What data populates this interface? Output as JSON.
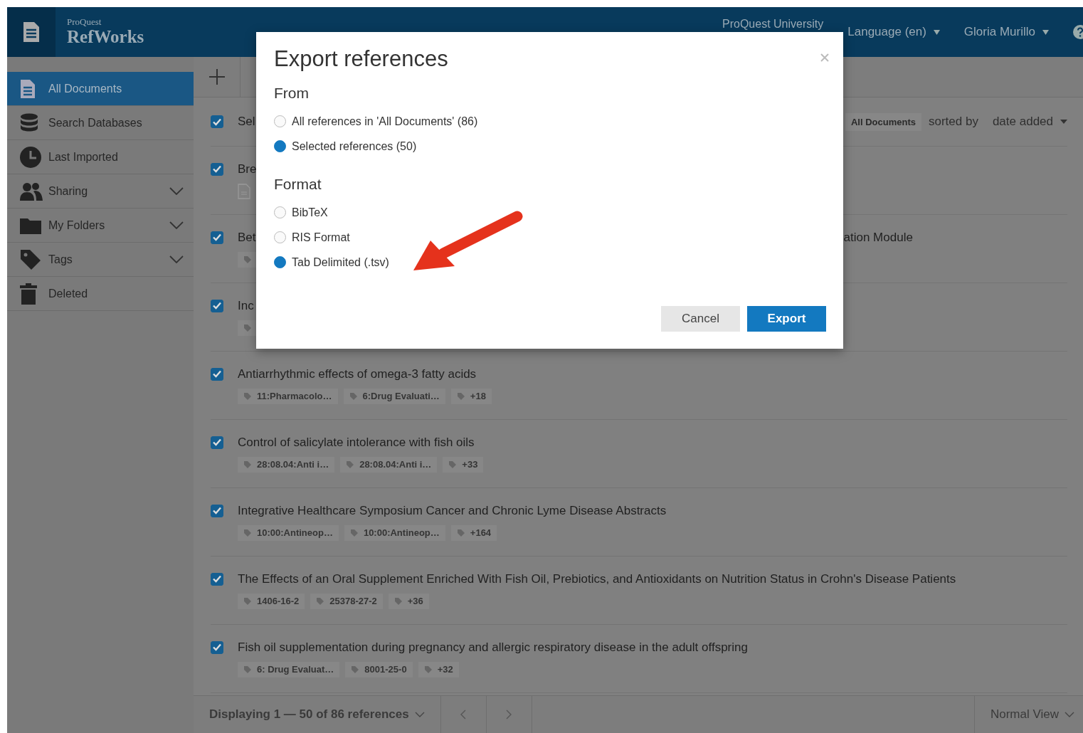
{
  "header": {
    "brand_small": "ProQuest",
    "brand": "RefWorks",
    "institution": "ProQuest University",
    "language": "Language (en)",
    "user": "Gloria Murillo"
  },
  "sidebar": {
    "items": [
      {
        "label": "All Documents",
        "selected": true,
        "expandable": false
      },
      {
        "label": "Search Databases",
        "selected": false,
        "expandable": false
      },
      {
        "label": "Last Imported",
        "selected": false,
        "expandable": false
      },
      {
        "label": "Sharing",
        "selected": false,
        "expandable": true
      },
      {
        "label": "My Folders",
        "selected": false,
        "expandable": true
      },
      {
        "label": "Tags",
        "selected": false,
        "expandable": true
      },
      {
        "label": "Deleted",
        "selected": false,
        "expandable": false
      }
    ]
  },
  "list": {
    "select_all": {
      "label": "Sel",
      "checked": true
    },
    "collection": "All Documents",
    "sort_label": "sorted by",
    "sort_value": "date added",
    "rows": [
      {
        "title": "Bre",
        "checked": true,
        "attachment": true,
        "tag_stub": false,
        "tags": []
      },
      {
        "title": "Bet",
        "title_tail": "ation Module",
        "checked": true,
        "attachment": false,
        "tag_stub": true,
        "tags": []
      },
      {
        "title": "Inc",
        "checked": true,
        "attachment": false,
        "tag_stub": true,
        "tags": []
      },
      {
        "title": "Antiarrhythmic effects of omega-3 fatty acids",
        "checked": true,
        "attachment": false,
        "tag_stub": false,
        "tags": [
          "11:Pharmacolo…",
          "6:Drug Evaluati…",
          "+18"
        ]
      },
      {
        "title": "Control of salicylate intolerance with fish oils",
        "checked": true,
        "attachment": false,
        "tag_stub": false,
        "tags": [
          "28:08.04:Anti i…",
          "28:08.04:Anti i…",
          "+33"
        ]
      },
      {
        "title": "Integrative Healthcare Symposium Cancer and Chronic Lyme Disease Abstracts",
        "checked": true,
        "attachment": false,
        "tag_stub": false,
        "tags": [
          "10:00:Antineop…",
          "10:00:Antineop…",
          "+164"
        ]
      },
      {
        "title": "The Effects of an Oral Supplement Enriched With Fish Oil, Prebiotics, and Antioxidants on Nutrition Status in Crohn's Disease Patients",
        "checked": true,
        "attachment": false,
        "tag_stub": false,
        "tags": [
          "1406-16-2",
          "25378-27-2",
          "+36"
        ]
      },
      {
        "title": "Fish oil supplementation during pregnancy and allergic respiratory disease in the adult offspring",
        "checked": true,
        "attachment": false,
        "tag_stub": false,
        "tags": [
          "6: Drug Evaluat…",
          "8001-25-0",
          "+32"
        ]
      }
    ]
  },
  "footer": {
    "displaying": "Displaying 1 — 50 of 86 references",
    "view": "Normal View"
  },
  "dialog": {
    "title": "Export references",
    "from_label": "From",
    "from_options": [
      {
        "label": "All references in 'All Documents' (86)",
        "selected": false
      },
      {
        "label": "Selected references (50)",
        "selected": true
      }
    ],
    "format_label": "Format",
    "format_options": [
      {
        "label": "BibTeX",
        "selected": false
      },
      {
        "label": "RIS Format",
        "selected": false
      },
      {
        "label": "Tab Delimited (.tsv)",
        "selected": true
      }
    ],
    "buttons": [
      {
        "label": "Cancel",
        "kind": "secondary"
      },
      {
        "label": "Export",
        "kind": "primary"
      }
    ]
  }
}
